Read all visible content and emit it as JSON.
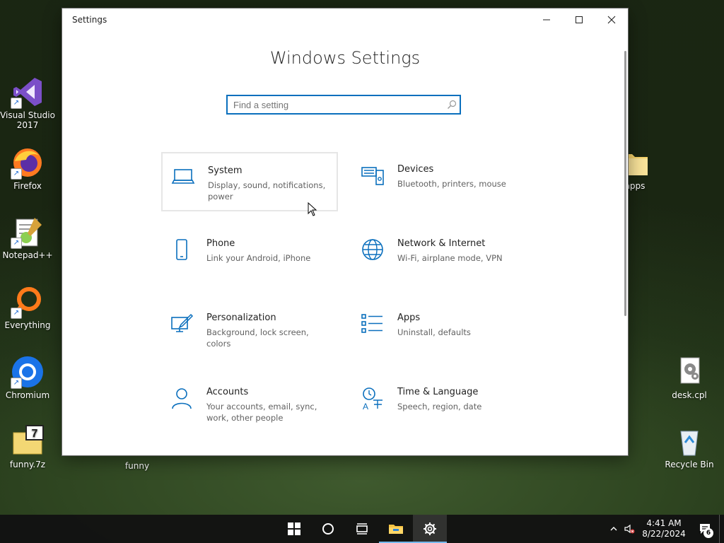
{
  "desktop": {
    "icons_left": [
      {
        "label": "Visual Studio\n2017",
        "icon": "visual-studio-icon"
      },
      {
        "label": "Firefox",
        "icon": "firefox-icon"
      },
      {
        "label": "Notepad++",
        "icon": "notepad-plus-plus-icon"
      },
      {
        "label": "Everything",
        "icon": "everything-search-icon"
      },
      {
        "label": "Chromium",
        "icon": "chromium-icon"
      },
      {
        "label": "funny.7z",
        "icon": "archive-7z-icon"
      }
    ],
    "funny_label": "funny",
    "apps_label": "apps",
    "desk_cpl_label": "desk.cpl",
    "recycle_bin_label": "Recycle Bin"
  },
  "window": {
    "title": "Settings",
    "heading": "Windows Settings",
    "search_placeholder": "Find a setting",
    "tiles": [
      {
        "name": "System",
        "desc": "Display, sound, notifications, power",
        "icon": "laptop-icon"
      },
      {
        "name": "Devices",
        "desc": "Bluetooth, printers, mouse",
        "icon": "keyboard-devices-icon"
      },
      {
        "name": "Phone",
        "desc": "Link your Android, iPhone",
        "icon": "phone-icon"
      },
      {
        "name": "Network & Internet",
        "desc": "Wi-Fi, airplane mode, VPN",
        "icon": "globe-icon"
      },
      {
        "name": "Personalization",
        "desc": "Background, lock screen, colors",
        "icon": "paint-brush-icon"
      },
      {
        "name": "Apps",
        "desc": "Uninstall, defaults",
        "icon": "apps-list-icon"
      },
      {
        "name": "Accounts",
        "desc": "Your accounts, email, sync, work, other people",
        "icon": "person-icon"
      },
      {
        "name": "Time & Language",
        "desc": "Speech, region, date",
        "icon": "time-language-icon"
      }
    ]
  },
  "taskbar": {
    "time": "4:41 AM",
    "date": "8/22/2024",
    "notification_count": "6"
  },
  "colors": {
    "accent": "#0a6fbd",
    "taskbar_bg": "#121212",
    "underline": "#76b9ed"
  }
}
